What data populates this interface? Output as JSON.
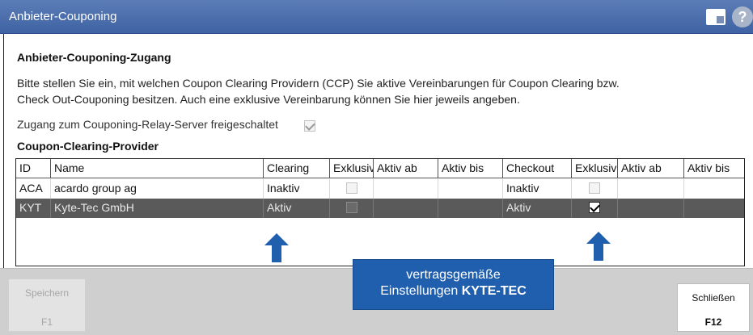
{
  "window": {
    "title": "Anbieter-Couponing",
    "icons": [
      "note-icon",
      "help-icon"
    ]
  },
  "heading": "Anbieter-Couponing-Zugang",
  "description": [
    "Bitte stellen Sie ein, mit welchen Coupon Clearing Providern (CCP) Sie aktive Vereinbarungen für Coupon Clearing bzw.",
    "Check Out-Couponing besitzen. Auch eine exklusive Vereinbarung können Sie hier jeweils angeben."
  ],
  "relay": {
    "label": "Zugang zum Couponing-Relay-Server freigeschaltet",
    "checked": true
  },
  "provider_section": "Coupon-Clearing-Provider",
  "table": {
    "headers": [
      "ID",
      "Name",
      "Clearing",
      "Exklusiv",
      "Aktiv ab",
      "Aktiv bis",
      "Checkout",
      "Exklusiv",
      "Aktiv ab",
      "Aktiv bis"
    ],
    "rows": [
      {
        "id": "ACA",
        "name": "acardo group ag",
        "clearing": "Inaktiv",
        "clearing_exklusiv": false,
        "clearing_ab": "",
        "clearing_bis": "",
        "checkout": "Inaktiv",
        "checkout_exklusiv": false,
        "checkout_ab": "",
        "checkout_bis": "",
        "selected": false
      },
      {
        "id": "KYT",
        "name": "Kyte-Tec GmbH",
        "clearing": "Aktiv",
        "clearing_exklusiv": false,
        "clearing_ab": "",
        "clearing_bis": "",
        "checkout": "Aktiv",
        "checkout_exklusiv": true,
        "checkout_ab": "",
        "checkout_bis": "",
        "selected": true
      }
    ]
  },
  "callout": {
    "line1": "vertragsgemäße",
    "line2_prefix": "Einstellungen ",
    "line2_bold": "KYTE-TEC",
    "color": "#1f5fad"
  },
  "buttons": {
    "save": {
      "label": "Speichern",
      "key": "F1",
      "enabled": false
    },
    "close": {
      "label": "Schließen",
      "key": "F12",
      "enabled": true
    }
  },
  "colors": {
    "titlebar": "#4a6dac",
    "selected_row": "#5a5a5a",
    "arrow": "#1f5fad"
  }
}
